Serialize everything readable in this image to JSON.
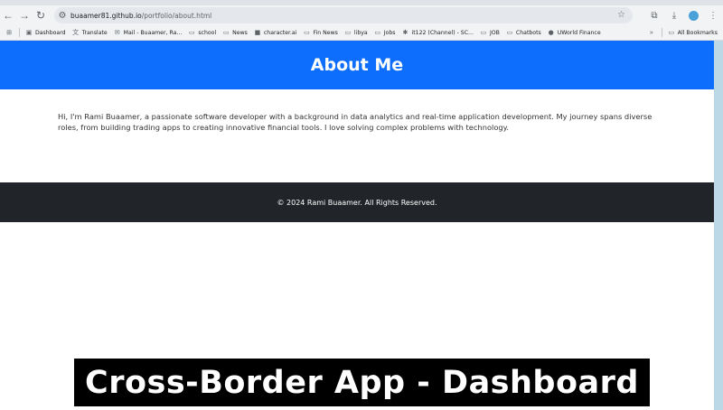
{
  "browser": {
    "url_domain": "buaamer81.github.io",
    "url_path": "/portfolio/about.html",
    "bookmarks": [
      {
        "icon": "dashboard-icon",
        "glyph": "▣",
        "label": "Dashboard"
      },
      {
        "icon": "translate-icon",
        "glyph": "文",
        "label": "Translate"
      },
      {
        "icon": "mail-icon",
        "glyph": "✉",
        "label": "Mail - Buaamer, Ra..."
      },
      {
        "icon": "folder-icon",
        "glyph": "▭",
        "label": "school"
      },
      {
        "icon": "folder-icon",
        "glyph": "▭",
        "label": "News"
      },
      {
        "icon": "character-ai-icon",
        "glyph": "■",
        "label": "character.ai"
      },
      {
        "icon": "folder-icon",
        "glyph": "▭",
        "label": "Fin News"
      },
      {
        "icon": "folder-icon",
        "glyph": "▭",
        "label": "libya"
      },
      {
        "icon": "folder-icon",
        "glyph": "▭",
        "label": "Jobs"
      },
      {
        "icon": "slack-icon",
        "glyph": "✱",
        "label": "it122 (Channel) - SC..."
      },
      {
        "icon": "folder-icon",
        "glyph": "▭",
        "label": "JOB"
      },
      {
        "icon": "folder-icon",
        "glyph": "▭",
        "label": "Chatbots"
      },
      {
        "icon": "uworld-icon",
        "glyph": "●",
        "label": "UWorld Finance"
      }
    ],
    "all_bookmarks_label": "All Bookmarks"
  },
  "page": {
    "title": "About Me",
    "body": "Hi, I'm Rami Buaamer, a passionate software developer with a background in data analytics and real-time application development. My journey spans diverse roles, from building trading apps to creating innovative financial tools. I love solving complex problems with technology.",
    "footer": "© 2024 Rami Buaamer. All Rights Reserved."
  },
  "caption": "Cross-Border App - Dashboard",
  "colors": {
    "hero": "#0d6efd",
    "footer": "#212529"
  }
}
